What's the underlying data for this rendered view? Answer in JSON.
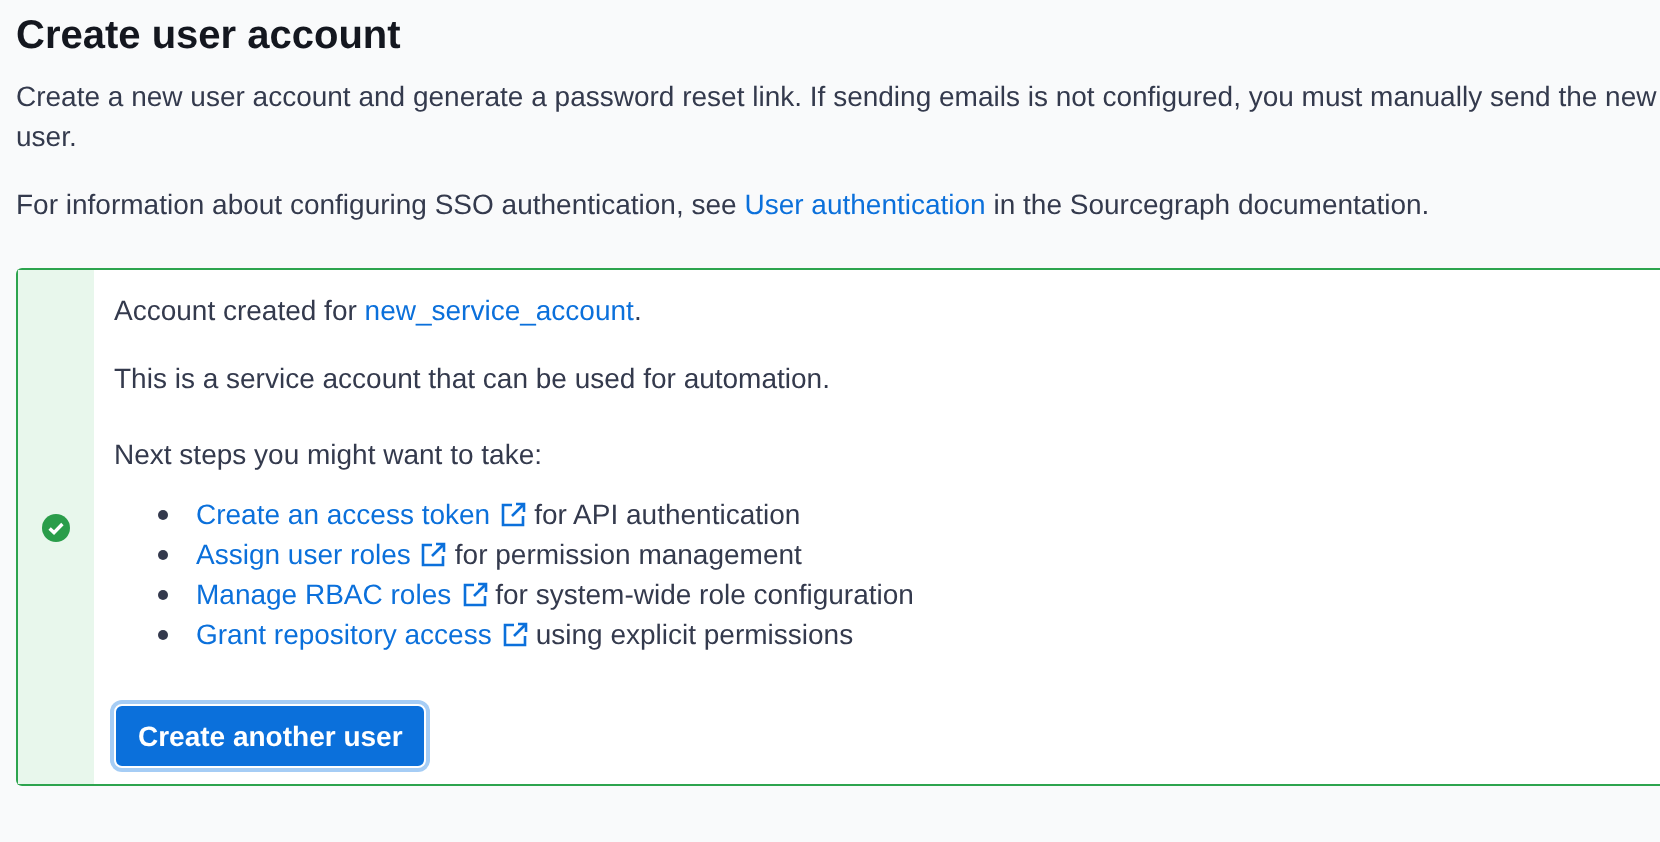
{
  "page": {
    "title": "Create user account",
    "description": "Create a new user account and generate a password reset link. If sending emails is not configured, you must manually send the new user.",
    "sso_note": {
      "before": "For information about configuring SSO authentication, see ",
      "link": "User authentication",
      "after": " in the Sourcegraph documentation."
    }
  },
  "alert": {
    "kind": "success",
    "created_prefix": "Account created for ",
    "username": "new_service_account",
    "created_suffix": ".",
    "service_note": "This is a service account that can be used for automation.",
    "next_steps_label": "Next steps you might want to take:",
    "steps": [
      {
        "link": "Create an access token",
        "detail": "for API authentication"
      },
      {
        "link": "Assign user roles",
        "detail": "for permission management"
      },
      {
        "link": "Manage RBAC roles",
        "detail": "for system-wide role configuration"
      },
      {
        "link": "Grant repository access",
        "detail": "using explicit permissions"
      }
    ],
    "button": "Create another user"
  }
}
